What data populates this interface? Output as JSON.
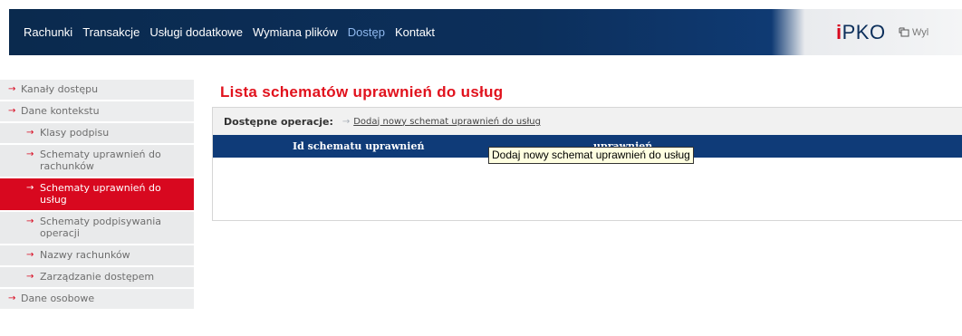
{
  "nav": {
    "items": [
      "Rachunki",
      "Transakcje",
      "Usługi dodatkowe",
      "Wymiana plików",
      "Dostęp",
      "Kontakt"
    ],
    "active": "Dostęp"
  },
  "logo": {
    "i": "i",
    "rest": "PKO"
  },
  "logout": {
    "label": "Wyl",
    "icon": "logout-icon"
  },
  "sidebar": {
    "items": [
      {
        "label": "Kanały dostępu",
        "level": 1,
        "active": false
      },
      {
        "label": "Dane kontekstu",
        "level": 1,
        "active": false
      },
      {
        "label": "Klasy podpisu",
        "level": 2,
        "active": false
      },
      {
        "label": "Schematy uprawnień do rachunków",
        "level": 2,
        "active": false
      },
      {
        "label": "Schematy uprawnień do usług",
        "level": 2,
        "active": true
      },
      {
        "label": "Schematy podpisywania operacji",
        "level": 2,
        "active": false
      },
      {
        "label": "Nazwy rachunków",
        "level": 2,
        "active": false
      },
      {
        "label": "Zarządzanie dostępem",
        "level": 2,
        "active": false
      },
      {
        "label": "Dane osobowe",
        "level": 1,
        "active": false
      }
    ],
    "arrow": "→"
  },
  "main": {
    "title": "Lista schematów uprawnień do usług",
    "operations_label": "Dostępne operacje:",
    "add_link": "Dodaj nowy schemat uprawnień do usług",
    "columns": [
      "Id schematu uprawnień",
      "uprawnień"
    ],
    "tooltip": "Dodaj nowy schemat uprawnień do usług"
  },
  "colors": {
    "brand_red": "#d8081f",
    "nav_blue": "#0c2f5b",
    "table_header": "#0f3b78",
    "active_nav": "#8fb8ee"
  }
}
